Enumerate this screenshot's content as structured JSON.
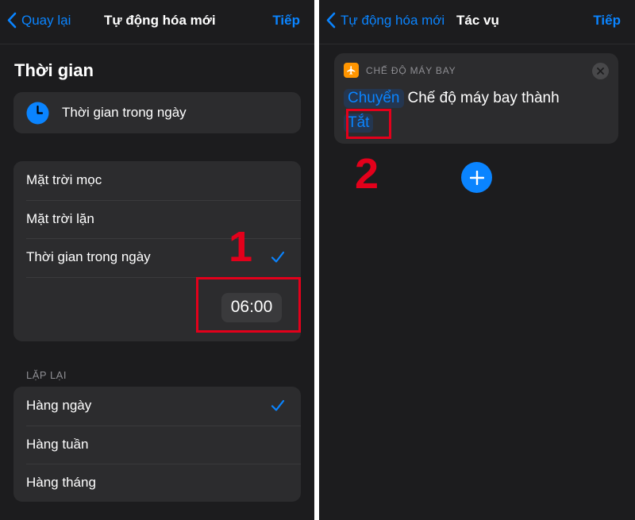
{
  "left": {
    "nav": {
      "back_label": "Quay lại",
      "title": "Tự động hóa mới",
      "next_label": "Tiếp"
    },
    "section_title": "Thời gian",
    "time_of_day_card": {
      "label": "Thời gian trong ngày",
      "icon": "clock-icon"
    },
    "options": [
      {
        "label": "Mặt trời mọc",
        "selected": false
      },
      {
        "label": "Mặt trời lặn",
        "selected": false
      },
      {
        "label": "Thời gian trong ngày",
        "selected": true
      }
    ],
    "time_value": "06:00",
    "repeat_caption": "LẶP LẠI",
    "repeat_options": [
      {
        "label": "Hàng ngày",
        "selected": true
      },
      {
        "label": "Hàng tuần",
        "selected": false
      },
      {
        "label": "Hàng tháng",
        "selected": false
      }
    ],
    "annotation_number": "1"
  },
  "right": {
    "nav": {
      "back_label": "Tự động hóa mới",
      "title": "Tác vụ",
      "next_label": "Tiếp"
    },
    "action": {
      "category": "CHẾ ĐỘ MÁY BAY",
      "icon": "airplane-icon",
      "verb_token": "Chuyển",
      "text": "Chế độ máy bay thành",
      "value_token": "Tắt"
    },
    "annotation_number": "2"
  },
  "colors": {
    "accent": "#0a84ff",
    "background": "#1c1c1e",
    "card": "#2c2c2e",
    "annotation": "#e3001b",
    "airplane": "#ff9500"
  }
}
